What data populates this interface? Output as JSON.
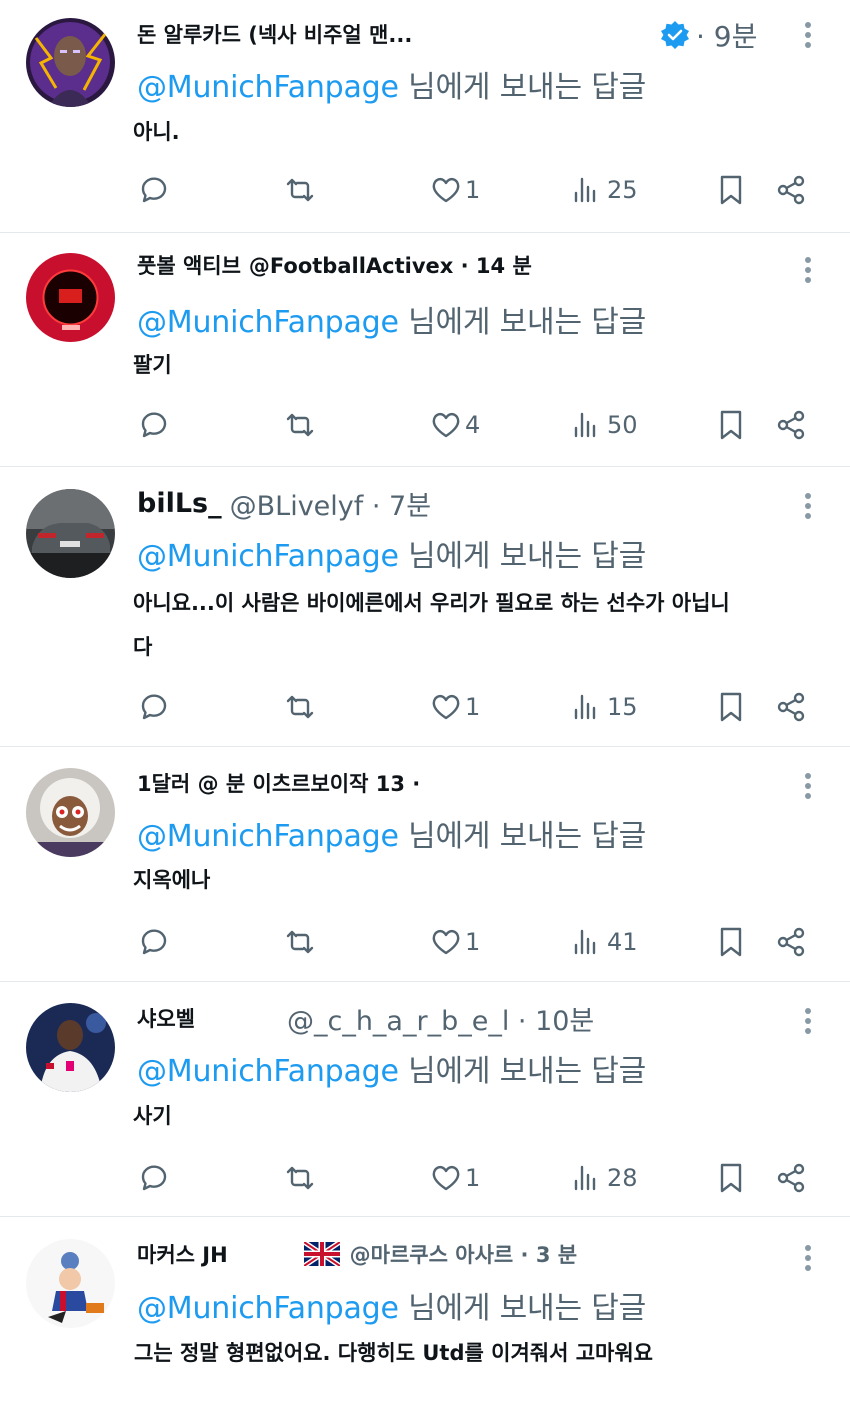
{
  "reply_prefix": "@MunichFanpage",
  "reply_suffix": " 님에게 보내는 답글",
  "colors": {
    "accent": "#1d9bf0",
    "muted": "#536471",
    "text": "#0f1419"
  },
  "tweets": [
    {
      "name": "돈 알루카드 (넥사 비주얼 맨...",
      "handle": "",
      "time": "· 9분",
      "verified": true,
      "text": "아니.",
      "likes": "1",
      "views": "25",
      "avatar_icon": "purple-lightning-man-avatar-icon"
    },
    {
      "name": "풋볼 액티브",
      "handle": "@FootballActivex · 14 분",
      "time": "",
      "verified": false,
      "text": "팔기",
      "likes": "4",
      "views": "50",
      "avatar_icon": "red-circle-logo-avatar-icon"
    },
    {
      "name": "bilLs_",
      "handle": "@BLivelyf · 7분",
      "time": "",
      "verified": false,
      "text": "아니요...이 사람은 바이에른에서 우리가 필요로 하는 선수가 아닙니다",
      "likes": "1",
      "views": "15",
      "avatar_icon": "car-avatar-icon"
    },
    {
      "name": "1달러 @ 분 이츠르보이작 13 ·",
      "handle": "",
      "time": "",
      "verified": false,
      "text": "지옥에나",
      "likes": "1",
      "views": "41",
      "avatar_icon": "anime-character-avatar-icon"
    },
    {
      "name": "샤오벨",
      "handle": "@_c_h_a_r_b_e_l · 10분",
      "time": "",
      "verified": false,
      "text": "사기",
      "likes": "1",
      "views": "28",
      "avatar_icon": "footballer-avatar-icon"
    },
    {
      "name": "마커스 JH",
      "handle": "@마르쿠스 아사르 · 3 분",
      "time": "",
      "verified": false,
      "text": "그는 정말 형편없어요. 다행히도 Utd를 이겨줘서 고마워요",
      "likes": "",
      "views": "",
      "avatar_icon": "cartoon-avatar-icon"
    }
  ]
}
